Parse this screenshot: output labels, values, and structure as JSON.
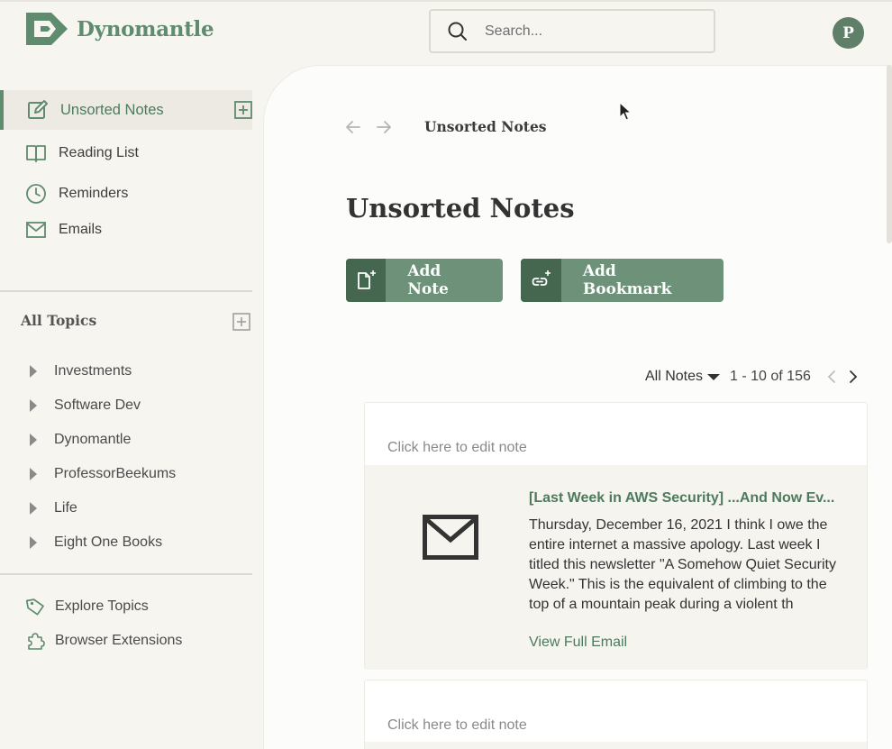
{
  "app": {
    "name": "Dynomantle",
    "avatar_initial": "P",
    "brand_color": "#5f8b6e"
  },
  "search": {
    "placeholder": "Search..."
  },
  "sidebar": {
    "nav": [
      {
        "label": "Unsorted Notes",
        "icon": "edit-icon",
        "active": true
      },
      {
        "label": "Reading List",
        "icon": "book-icon"
      },
      {
        "label": "Reminders",
        "icon": "clock-icon"
      },
      {
        "label": "Emails",
        "icon": "mail-icon"
      }
    ],
    "topics_title": "All Topics",
    "topics": [
      "Investments",
      "Software Dev",
      "Dynomantle",
      "ProfessorBeekums",
      "Life",
      "Eight One Books"
    ],
    "bottom": [
      {
        "label": "Explore Topics",
        "icon": "tag-icon"
      },
      {
        "label": "Browser Extensions",
        "icon": "puzzle-icon"
      }
    ]
  },
  "main": {
    "breadcrumb": "Unsorted Notes",
    "title": "Unsorted Notes",
    "add_note_label": "Add Note",
    "add_bookmark_label": "Add Bookmark",
    "filter_label": "All Notes",
    "range_label": "1 - 10 of 156",
    "cards": [
      {
        "edit_placeholder": "Click here to edit note",
        "email_title": "[Last Week in AWS Security] ...And Now Ev...",
        "email_body": "Thursday, December 16, 2021 I think I owe the entire internet a massive apology. Last week I titled this newsletter \"A Somehow Quiet Security Week.\" This is the equivalent of climbing to the top of a mountain peak during a violent th",
        "email_link": "View Full Email"
      },
      {
        "edit_placeholder": "Click here to edit note"
      }
    ]
  }
}
